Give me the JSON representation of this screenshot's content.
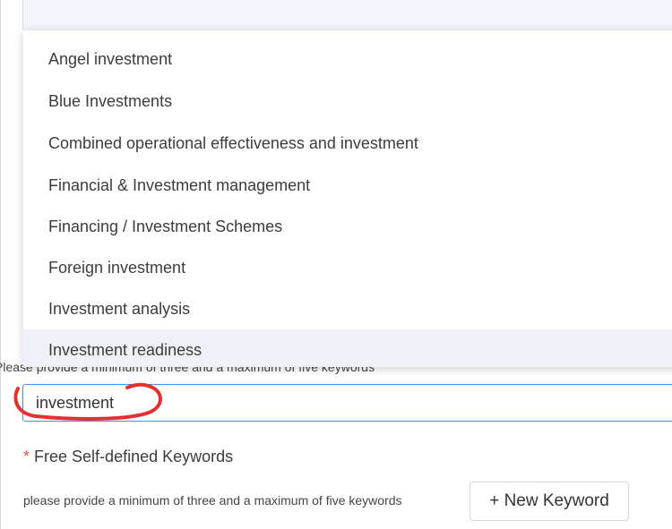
{
  "dropdown": {
    "items": [
      "Angel investment",
      "Blue Investments",
      "Combined operational effectiveness and investment",
      "Financial & Investment management",
      "Financing / Investment Schemes",
      "Foreign investment",
      "Investment analysis",
      "Investment readiness"
    ],
    "highlighted_index": 7
  },
  "keywords_field": {
    "hint": "Please provide a minimum of three and a maximum of five keywords",
    "value": "investment"
  },
  "free_keywords": {
    "required_mark": "*",
    "label": "Free Self-defined Keywords",
    "hint": "please provide a minimum of three and a maximum of five keywords",
    "new_button_label": "+ New Keyword"
  },
  "colors": {
    "focus_border": "#4a90e2",
    "required": "#e8544a",
    "annotation": "#e53030",
    "highlight": "#eef2f7"
  }
}
